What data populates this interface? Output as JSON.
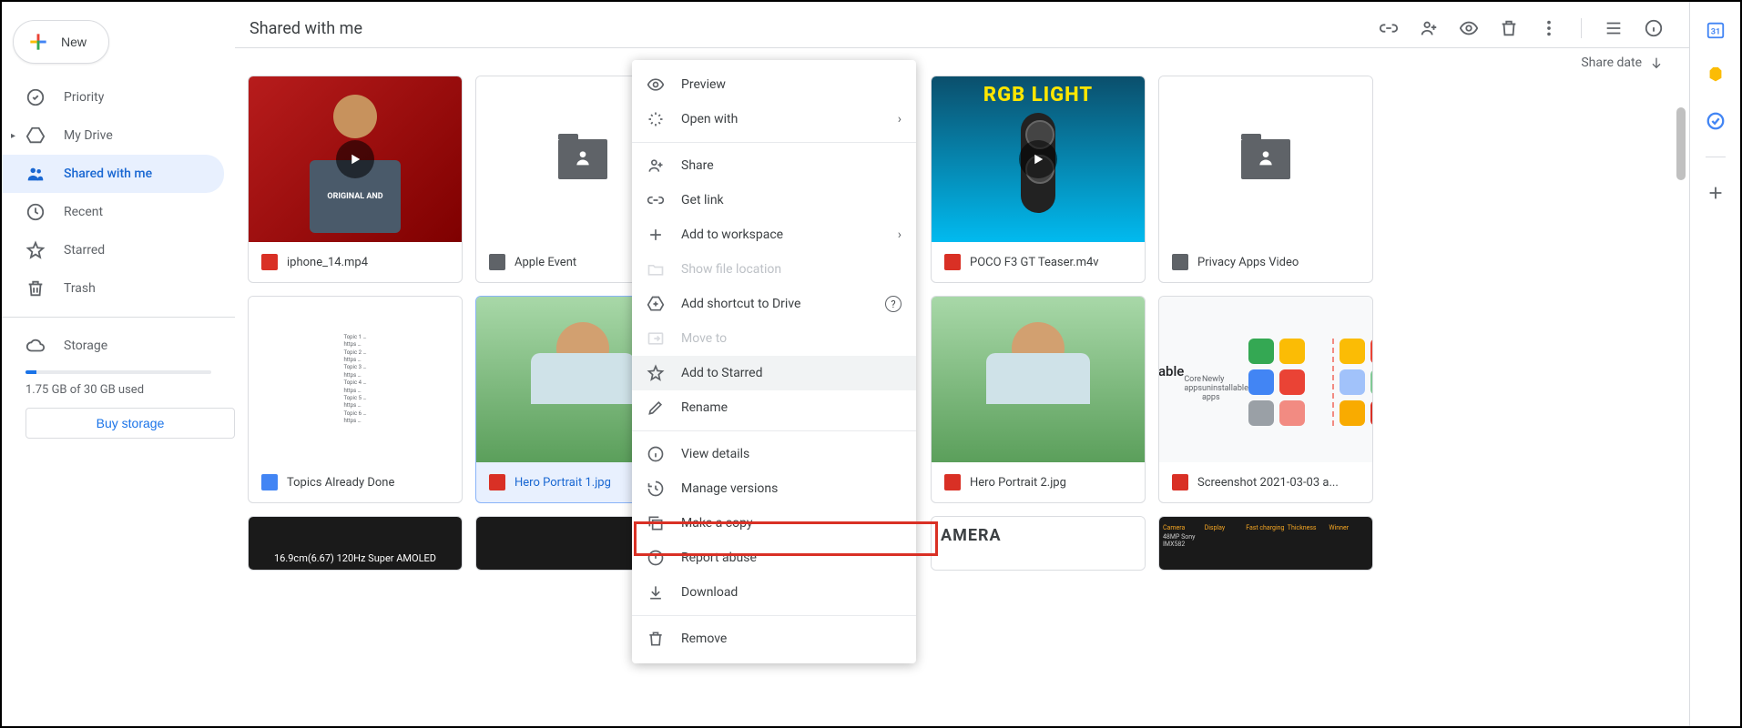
{
  "sidebar": {
    "new_label": "New",
    "items": [
      {
        "label": "Priority"
      },
      {
        "label": "My Drive"
      },
      {
        "label": "Shared with me"
      },
      {
        "label": "Recent"
      },
      {
        "label": "Starred"
      },
      {
        "label": "Trash"
      }
    ],
    "storage_label": "Storage",
    "storage_used": "1.75 GB of 30 GB used",
    "buy_storage": "Buy storage"
  },
  "header": {
    "title": "Shared with me",
    "sort_label": "Share date"
  },
  "files": [
    {
      "name": "iphone_14.mp4",
      "type": "video"
    },
    {
      "name": "Apple Event",
      "type": "folder"
    },
    {
      "name": "",
      "type": "hidden"
    },
    {
      "name": "POCO F3 GT Teaser.m4v",
      "type": "video"
    },
    {
      "name": "Privacy Apps Video",
      "type": "folder"
    },
    {
      "name": "Topics Already Done",
      "type": "gdoc"
    },
    {
      "name": "Hero Portrait 1.jpg",
      "type": "image",
      "selected": true
    },
    {
      "name": "",
      "type": "hidden"
    },
    {
      "name": "Hero Portrait 2.jpg",
      "type": "image"
    },
    {
      "name": "Screenshot 2021-03-03 a...",
      "type": "image"
    }
  ],
  "thumbs": {
    "rgb_title": "RGB LIGHT",
    "tshirt_text": "ORIGINAL\nAND",
    "amoled": "16.9cm(6.67) 120Hz Super AMOLED",
    "camera": "AMERA",
    "uninstall_title": "Uninstallable system",
    "core_apps": "Core apps",
    "new_uninstall": "Newly uninstallable apps"
  },
  "context_menu": {
    "items": [
      {
        "label": "Preview"
      },
      {
        "label": "Open with",
        "chevron": true
      },
      {
        "sep": true
      },
      {
        "label": "Share"
      },
      {
        "label": "Get link"
      },
      {
        "label": "Add to workspace",
        "chevron": true
      },
      {
        "label": "Show file location",
        "disabled": true
      },
      {
        "label": "Add shortcut to Drive",
        "help": true
      },
      {
        "label": "Move to",
        "disabled": true
      },
      {
        "label": "Add to Starred",
        "hover": true
      },
      {
        "label": "Rename"
      },
      {
        "sep": true
      },
      {
        "label": "View details"
      },
      {
        "label": "Manage versions"
      },
      {
        "label": "Make a copy"
      },
      {
        "label": "Report abuse"
      },
      {
        "label": "Download"
      },
      {
        "sep": true
      },
      {
        "label": "Remove"
      }
    ]
  }
}
